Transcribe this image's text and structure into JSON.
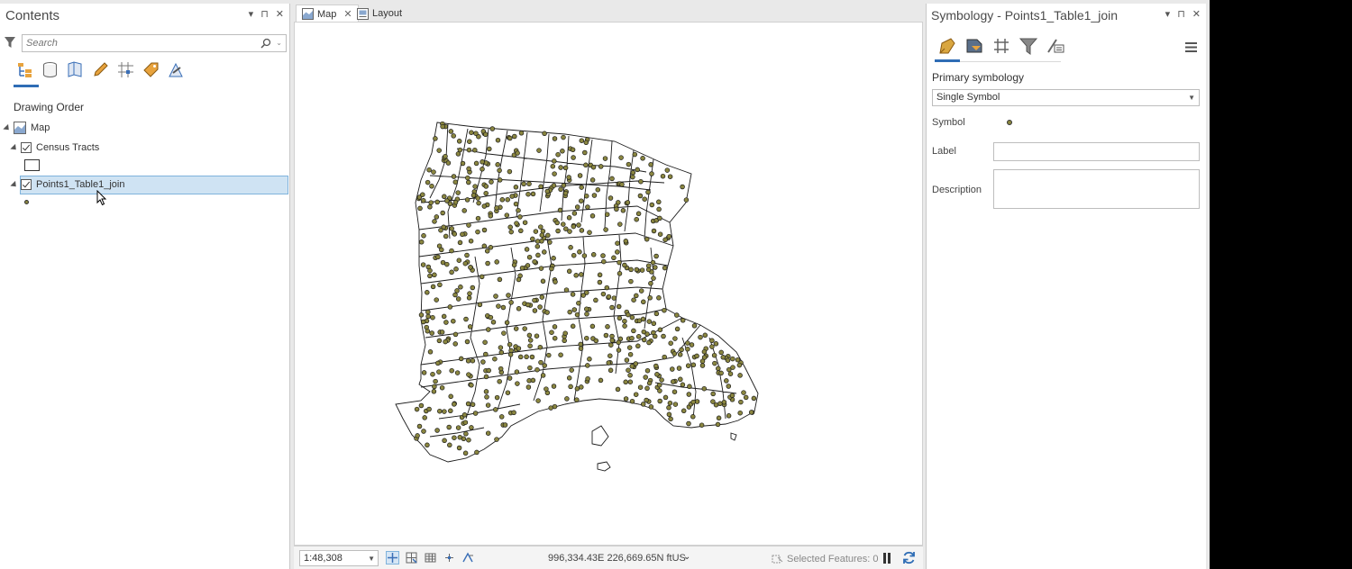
{
  "contents": {
    "title": "Contents",
    "controls": [
      "▾",
      "⊓",
      "✕"
    ],
    "search_placeholder": "Search",
    "drawing_order": "Drawing Order",
    "map_label": "Map",
    "layers": [
      {
        "name": "Census Tracts",
        "checked": true
      },
      {
        "name": "Points1_Table1_join",
        "checked": true,
        "selected": true
      }
    ]
  },
  "view_tabs": [
    {
      "label": "Map",
      "active": true,
      "close": "✕"
    },
    {
      "label": "Layout",
      "active": false
    }
  ],
  "map": {
    "point_color": "#8a8640",
    "outline_color": "#1a1a1a"
  },
  "statusbar": {
    "scale": "1:48,308",
    "coordinates": "996,334.43E 226,669.65N ftUS",
    "selected_features": "Selected Features: 0"
  },
  "symbology": {
    "title": "Symbology - Points1_Table1_join",
    "controls": [
      "▾",
      "⊓",
      "✕"
    ],
    "primary_label": "Primary symbology",
    "primary_value": "Single Symbol",
    "symbol_label": "Symbol",
    "label_label": "Label",
    "label_value": "",
    "description_label": "Description",
    "description_value": ""
  }
}
